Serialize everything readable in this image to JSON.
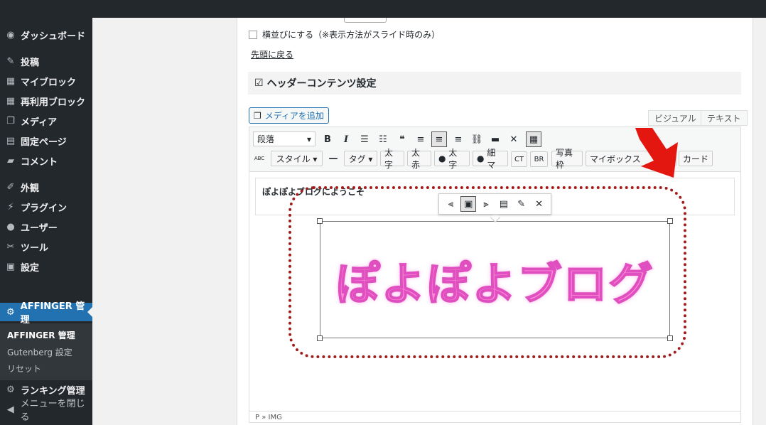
{
  "sidebar": {
    "items": [
      {
        "icon": "dashboard-icon",
        "glyph": "◉",
        "label": "ダッシュボード"
      },
      {
        "icon": "pin-icon",
        "glyph": "✎",
        "label": "投稿"
      },
      {
        "icon": "blocks-icon",
        "glyph": "▦",
        "label": "マイブロック"
      },
      {
        "icon": "blocks-icon",
        "glyph": "▦",
        "label": "再利用ブロック"
      },
      {
        "icon": "media-icon",
        "glyph": "❐",
        "label": "メディア"
      },
      {
        "icon": "page-icon",
        "glyph": "▤",
        "label": "固定ページ"
      },
      {
        "icon": "comment-icon",
        "glyph": "▰",
        "label": "コメント"
      },
      {
        "icon": "appearance-icon",
        "glyph": "✐",
        "label": "外観"
      },
      {
        "icon": "plugin-icon",
        "glyph": "⚡",
        "label": "プラグイン"
      },
      {
        "icon": "user-icon",
        "glyph": "●",
        "label": "ユーザー"
      },
      {
        "icon": "tool-icon",
        "glyph": "✂",
        "label": "ツール"
      },
      {
        "icon": "settings-icon",
        "glyph": "▣",
        "label": "設定"
      }
    ],
    "active": {
      "icon": "gear-icon",
      "glyph": "⚙",
      "label": "AFFINGER 管理"
    },
    "submenu": [
      "AFFINGER 管理",
      "Gutenberg 設定",
      "リセット"
    ],
    "ranking": {
      "icon": "gear-icon",
      "glyph": "⚙",
      "label": "ランキング管理"
    },
    "collapse": {
      "icon": "collapse-icon",
      "glyph": "◀",
      "label": "メニューを閉じる"
    }
  },
  "main": {
    "checkbox_label": "横並びにする（※表示方法がスライド時のみ）",
    "back_link": "先頭に戻る",
    "section_title": "ヘッダーコンテンツ設定",
    "media_button": "メディアを追加",
    "tab_visual": "ビジュアル",
    "tab_text": "テキスト",
    "format_select": "段落",
    "toolbar_row2": {
      "style": "スタイル ▾",
      "tag": "タグ ▾",
      "btn1": "太字",
      "btn2": "太赤",
      "btn3": "太字",
      "btn4": "細マ",
      "btn5": "CT",
      "btn6": "BR",
      "btn7": "写真枠",
      "btn8": "マイボックス",
      "btn9": "カード"
    },
    "content_text": "ぽよぽよブログにようこそ",
    "image_text": "ぽよぽよブログ",
    "status_path": "P » IMG"
  },
  "colors": {
    "sidebar_bg": "#23282d",
    "active_bg": "#2271b1",
    "annotation": "#a11c1c",
    "arrow": "#e3170f",
    "logo": "#ff8ad8"
  }
}
